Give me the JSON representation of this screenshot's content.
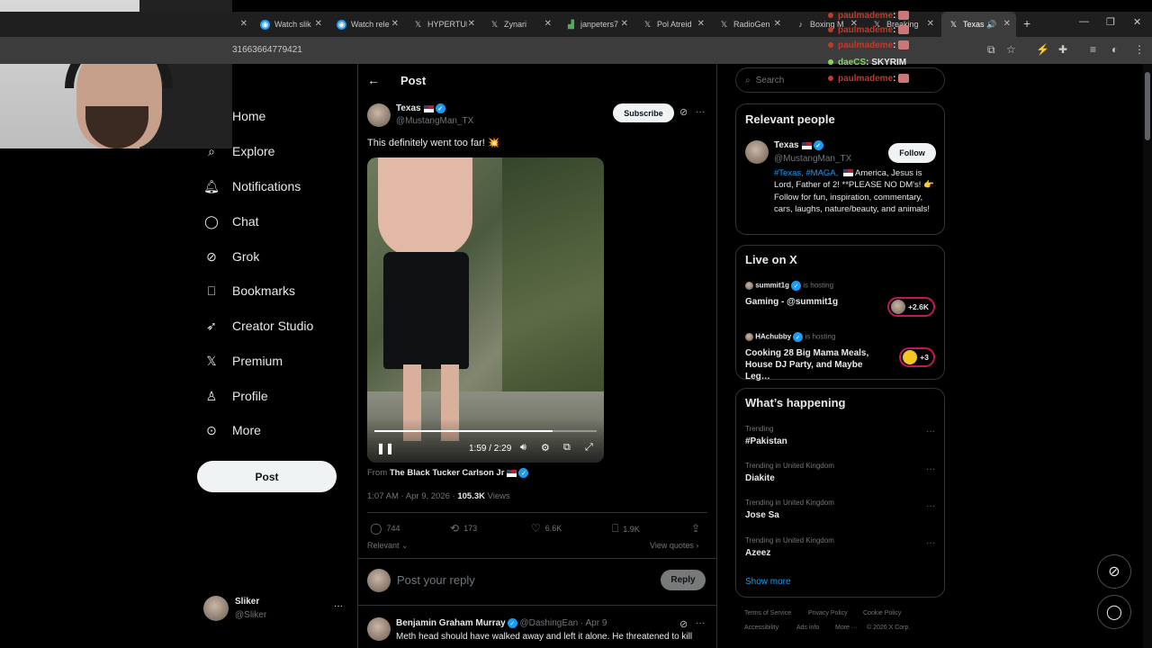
{
  "browser": {
    "tabs": [
      {
        "title": "Watch slik",
        "icon": "stream-icon"
      },
      {
        "title": "Watch rele",
        "icon": "stream-icon"
      },
      {
        "title": "HYPERTUN",
        "icon": "x-logo-icon"
      },
      {
        "title": "Zynari",
        "icon": "x-logo-icon"
      },
      {
        "title": "janpeters7",
        "icon": "chart-icon"
      },
      {
        "title": "Pol Atreid",
        "icon": "x-logo-icon"
      },
      {
        "title": "RadioGen",
        "icon": "x-logo-icon"
      },
      {
        "title": "Boxing M",
        "icon": "tiktok-icon"
      },
      {
        "title": "Breaking",
        "icon": "x-logo-icon"
      },
      {
        "title": "Texas",
        "icon": "x-logo-icon"
      }
    ],
    "new_tab": "+",
    "url": "31663664779421",
    "min": "—",
    "restore": "❐",
    "close": "✕"
  },
  "chat": [
    {
      "user": "paulmademe",
      "sep": ":",
      "color": "#c0392b"
    },
    {
      "user": "paulmademe",
      "sep": ":",
      "color": "#c0392b"
    },
    {
      "user": "paulmademe",
      "sep": ":",
      "color": "#c0392b"
    },
    {
      "user": "daeCS",
      "sep": ":",
      "text": "SKYRIM",
      "color": "#7ed957"
    },
    {
      "user": "paulmademe",
      "sep": ":",
      "color": "#c0392b"
    }
  ],
  "nav": {
    "items": [
      {
        "label": "Home",
        "icon": "home-icon"
      },
      {
        "label": "Explore",
        "icon": "search-icon"
      },
      {
        "label": "Notifications",
        "icon": "bell-icon"
      },
      {
        "label": "Chat",
        "icon": "chat-icon"
      },
      {
        "label": "Grok",
        "icon": "grok-icon"
      },
      {
        "label": "Bookmarks",
        "icon": "bookmark-icon"
      },
      {
        "label": "Creator Studio",
        "icon": "rocket-icon"
      },
      {
        "label": "Premium",
        "icon": "x-logo-icon"
      },
      {
        "label": "Profile",
        "icon": "person-icon"
      },
      {
        "label": "More",
        "icon": "more-circle-icon"
      }
    ],
    "post_label": "Post",
    "account": {
      "name": "Sliker",
      "handle": "@Sliker",
      "menu": "···"
    }
  },
  "post": {
    "header_title": "Post",
    "back": "←",
    "author": {
      "name": "Texas",
      "handle": "@MustangMan_TX"
    },
    "subscribe_label": "Subscribe",
    "more": "···",
    "text": "This definitely went too far! 💥",
    "video": {
      "time": "1:59 / 2:29",
      "progress": 0.8
    },
    "from_prefix": "From",
    "from_name": "The Black Tucker Carlson Jr",
    "meta_time": "1:07 AM · Apr 9, 2026 · ",
    "views_count": "105.3K",
    "views_label": " Views",
    "stats": {
      "replies": "744",
      "reposts": "173",
      "likes": "6.6K",
      "bookmarks": "1.9K"
    },
    "sort_label": "Relevant",
    "view_quotes": "View quotes",
    "reply_placeholder": "Post your reply",
    "reply_button": "Reply",
    "comment": {
      "name": "Benjamin Graham Murray",
      "handle": "@DashingEan",
      "date": "· Apr 9",
      "text": "Meth head should have walked away and left it alone. He threatened to kill"
    }
  },
  "right": {
    "search_placeholder": "Search",
    "relevant": {
      "title": "Relevant people",
      "name": "Texas",
      "handle": "@MustangMan_TX",
      "follow": "Follow",
      "bio_tags": "#Texas, #MAGA,",
      "bio_text": " America, Jesus is Lord, Father of 2! **PLEASE NO DM's! 👉 Follow for fun, inspiration, commentary, cars, laughs, nature/beauty, and animals!"
    },
    "live": {
      "title": "Live on X",
      "items": [
        {
          "host": "summit1g",
          "hosting": "is hosting",
          "title": "Gaming - @summit1g",
          "count": "+2.6K"
        },
        {
          "host": "HAchubby",
          "hosting": "is hosting",
          "title": "Cooking 28 Big Mama Meals, House DJ Party, and Maybe Leg…",
          "count": "+3"
        }
      ]
    },
    "happening": {
      "title": "What’s happening",
      "items": [
        {
          "meta": "Trending",
          "name": "#Pakistan"
        },
        {
          "meta": "Trending in United Kingdom",
          "name": "Diakite"
        },
        {
          "meta": "Trending in United Kingdom",
          "name": "Jose Sa"
        },
        {
          "meta": "Trending in United Kingdom",
          "name": "Azeez"
        }
      ],
      "show_more": "Show more"
    },
    "footer": {
      "links": [
        "Terms of Service",
        "Privacy Policy",
        "Cookie Policy",
        "Accessibility",
        "Ads info",
        "More ···"
      ],
      "copyright": "© 2026 X Corp."
    }
  }
}
